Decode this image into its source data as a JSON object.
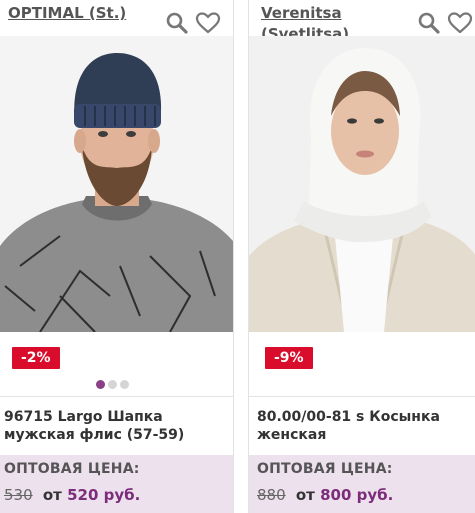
{
  "products": [
    {
      "brand": "OPTIMAL (St.)",
      "discount": "-2%",
      "title": "96715 Largo Шапка мужская флис (57-59)",
      "price_label": "ОПТОВАЯ ЦЕНА:",
      "old_price": "530",
      "from": "от",
      "price": "520 руб.",
      "carousel_dots": 3,
      "carousel_active": 1
    },
    {
      "brand": "Verenitsa (Svetlitsa)",
      "discount": "-9%",
      "title": "80.00/00-81 s Косынка женская",
      "price_label": "ОПТОВАЯ ЦЕНА:",
      "old_price": "880",
      "from": "от",
      "price": "800 руб."
    }
  ],
  "icons": {
    "search": "search-icon",
    "favorite": "heart-icon"
  },
  "colors": {
    "discount_bg": "#d90d2b",
    "price_bg": "#eee1ee",
    "price_accent": "#7b2d7b",
    "dot_active": "#8a3f86"
  }
}
